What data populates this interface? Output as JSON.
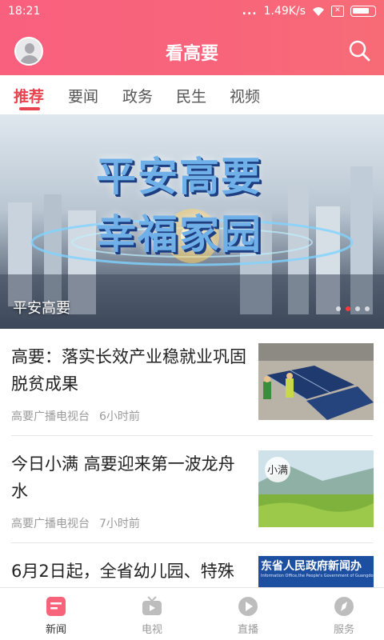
{
  "status_bar": {
    "time": "18:21",
    "signal_dots": "...",
    "speed": "1.49K/s"
  },
  "header": {
    "title": "看高要",
    "avatar_icon": "user-avatar-icon",
    "search_icon": "search-icon",
    "brand_color": "#f8637c"
  },
  "tabs": [
    {
      "label": "推荐",
      "active": true
    },
    {
      "label": "要闻",
      "active": false
    },
    {
      "label": "政务",
      "active": false
    },
    {
      "label": "民生",
      "active": false
    },
    {
      "label": "视频",
      "active": false
    }
  ],
  "banner": {
    "title": "平安高要",
    "line1": "平安高要",
    "line2": "幸福家园",
    "slides": 4,
    "active_slide": 2
  },
  "news": [
    {
      "title": "高要：落实长效产业稳就业巩固脱贫成果",
      "source": "高要广播电视台",
      "time": "6小时前",
      "thumb": "solar-panels"
    },
    {
      "title": "今日小满 高要迎来第一波龙舟水",
      "source": "高要广播电视台",
      "time": "7小时前",
      "thumb": "rice-field",
      "thumb_text": "小满"
    },
    {
      "title": "6月2日起，全省幼儿园、特殊",
      "thumb": "gov-banner",
      "thumb_text_cn": "东省人民政府新闻办",
      "thumb_text_en": "Information Office,the People's Government of Guangdong"
    }
  ],
  "bottom_nav": [
    {
      "label": "新闻",
      "icon": "news-icon",
      "active": true
    },
    {
      "label": "电视",
      "icon": "tv-icon",
      "active": false
    },
    {
      "label": "直播",
      "icon": "live-play-icon",
      "active": false
    },
    {
      "label": "服务",
      "icon": "compass-icon",
      "active": false
    }
  ],
  "colors": {
    "accent": "#e8434f",
    "inactive": "#b7b7b7"
  }
}
